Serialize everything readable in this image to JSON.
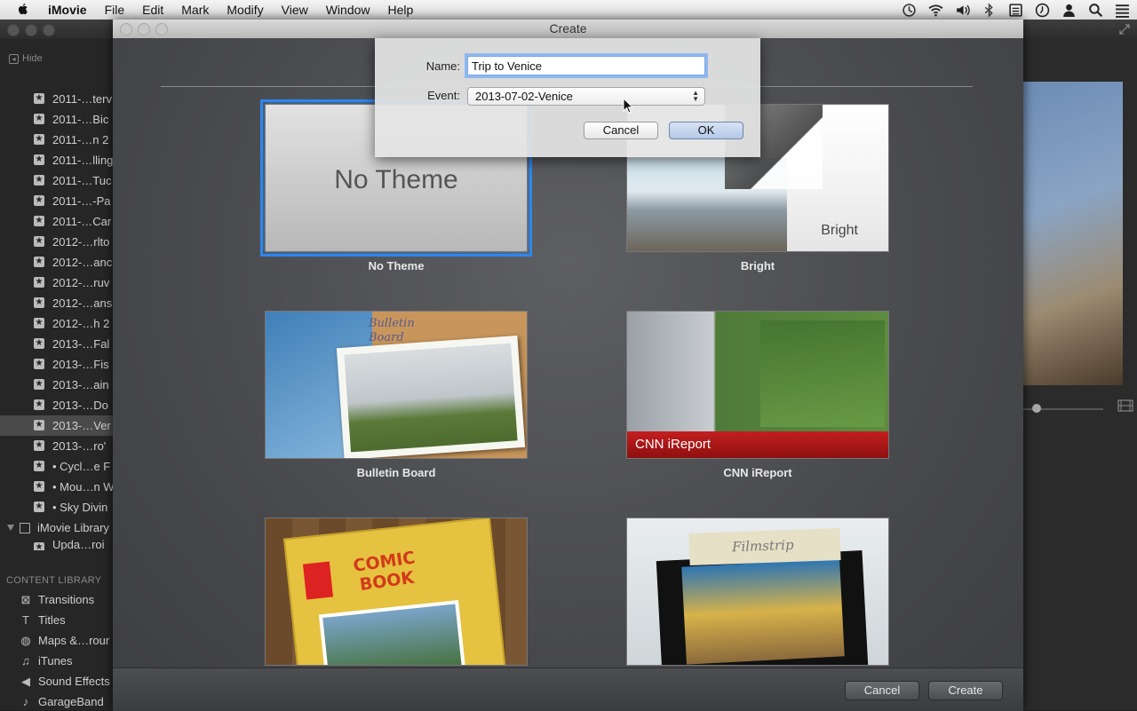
{
  "menubar": {
    "app_name": "iMovie",
    "menus": [
      "File",
      "Edit",
      "Mark",
      "Modify",
      "View",
      "Window",
      "Help"
    ],
    "status_icons": [
      "time-machine-icon",
      "wifi-icon",
      "volume-icon",
      "bluetooth-icon",
      "keyboard-icon",
      "clock-icon",
      "user-icon",
      "spotlight-icon",
      "list-icon"
    ]
  },
  "sidebar": {
    "hide_label": "Hide",
    "events": [
      {
        "label": "2011-…terv"
      },
      {
        "label": "2011-…Bic"
      },
      {
        "label": "2011-…n 2"
      },
      {
        "label": "2011-…lling"
      },
      {
        "label": "2011-…Tuc"
      },
      {
        "label": "2011-…-Pa"
      },
      {
        "label": "2011-…Car"
      },
      {
        "label": "2012-…rlto"
      },
      {
        "label": "2012-…anc"
      },
      {
        "label": "2012-…ruv"
      },
      {
        "label": "2012-…ans"
      },
      {
        "label": "2012-…h 2"
      },
      {
        "label": "2013-…Fal"
      },
      {
        "label": "2013-…Fis"
      },
      {
        "label": "2013-…ain"
      },
      {
        "label": "2013-…Do"
      },
      {
        "label": "2013-…Ver"
      },
      {
        "label": "2013-…ro'"
      },
      {
        "label": "• Cycl…e F"
      },
      {
        "label": "• Mou…n W"
      },
      {
        "label": "• Sky Divin"
      }
    ],
    "library_label": "iMovie Library",
    "library_child": "Upda…roi",
    "content_library": {
      "header": "CONTENT LIBRARY",
      "items": [
        {
          "label": "Transitions",
          "icon": "⊠"
        },
        {
          "label": "Titles",
          "icon": "T"
        },
        {
          "label": "Maps &…rour",
          "icon": "◍"
        },
        {
          "label": "iTunes",
          "icon": "♫"
        },
        {
          "label": "Sound Effects",
          "icon": "◀"
        },
        {
          "label": "GarageBand",
          "icon": "♪"
        }
      ]
    }
  },
  "sheet": {
    "title": "Create",
    "themes": [
      {
        "label": "No Theme",
        "thumb_text": "No Theme",
        "selected": true
      },
      {
        "label": "Bright",
        "thumb_text": "Bright"
      },
      {
        "label": "Bulletin Board",
        "thumb_text_1": "Bulletin",
        "thumb_text_2": "Board"
      },
      {
        "label": "CNN iReport",
        "thumb_text": "CNN iReport"
      },
      {
        "label": "",
        "thumb_text_1": "COMIC",
        "thumb_text_2": "BOOK"
      },
      {
        "label": "",
        "thumb_text": "Filmstrip"
      }
    ],
    "cancel_label": "Cancel",
    "create_label": "Create"
  },
  "dialog": {
    "name_label": "Name:",
    "name_value": "Trip to Venice",
    "event_label": "Event:",
    "event_value": "2013-07-02-Venice",
    "cancel_label": "Cancel",
    "ok_label": "OK"
  },
  "colors": {
    "selection_accent": "#2f86ea",
    "cnn_red": "#c41f1f"
  }
}
